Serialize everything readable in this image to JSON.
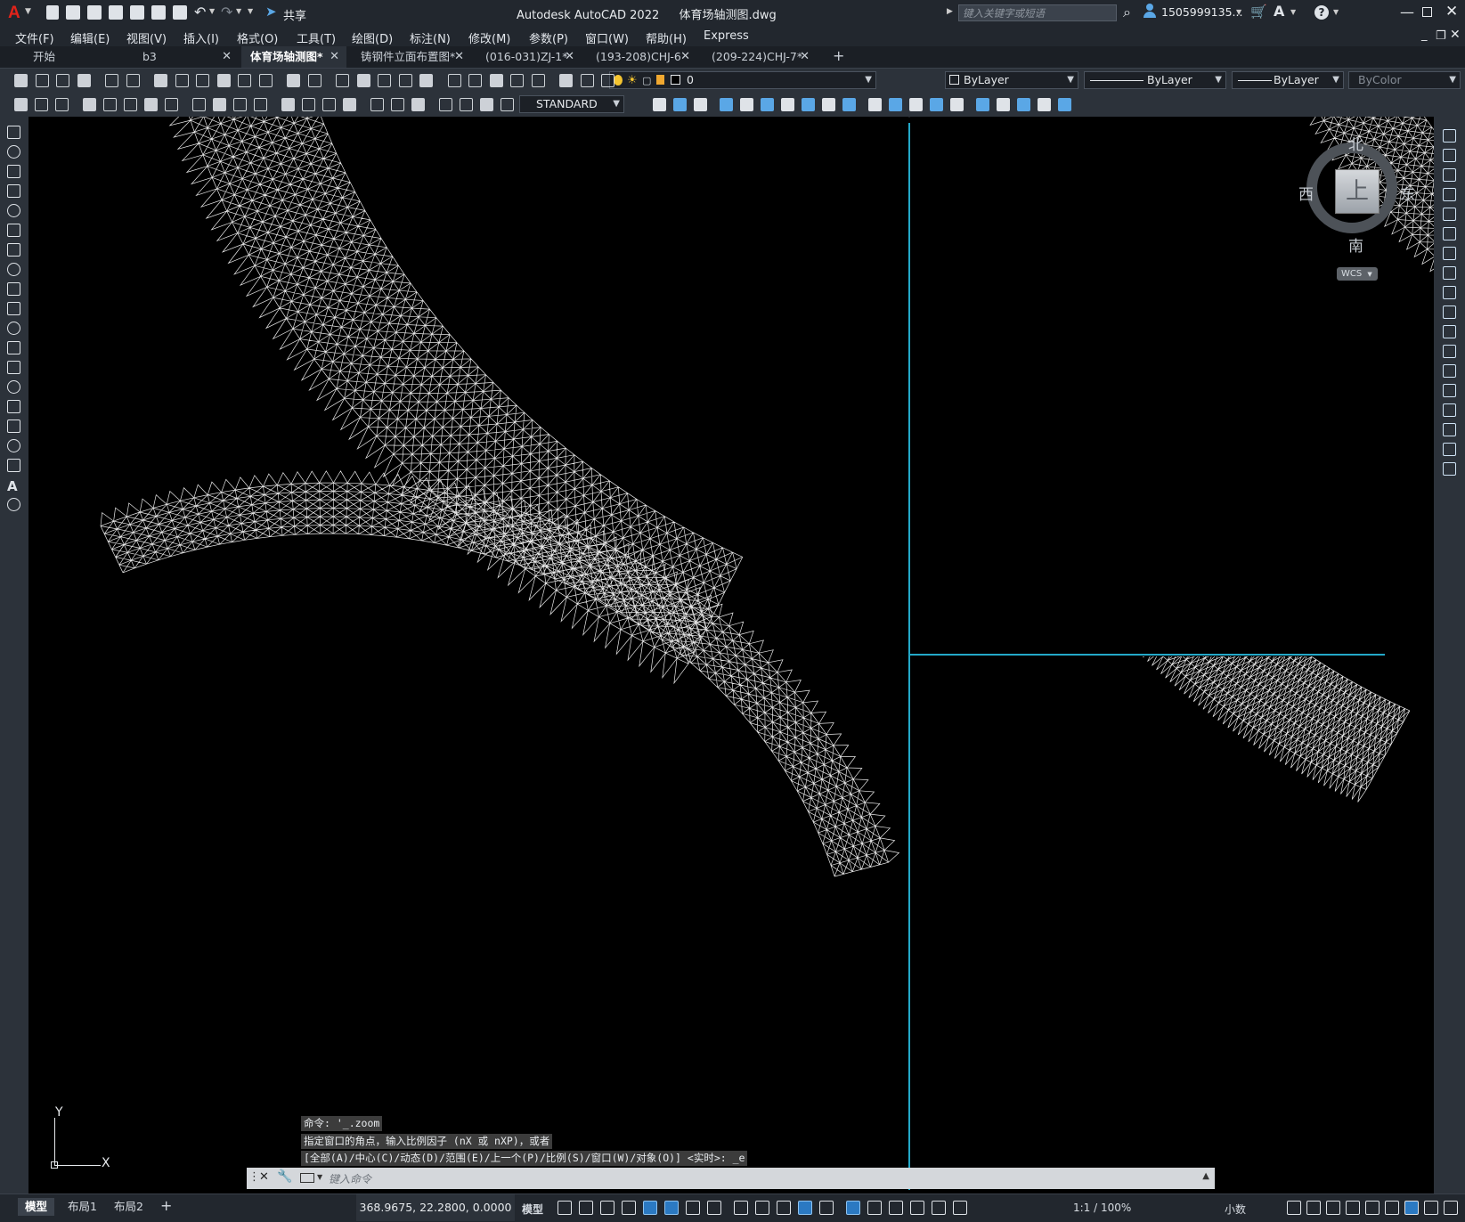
{
  "app": {
    "logo": "A",
    "title": "Autodesk AutoCAD 2022",
    "filename": "体育场轴测图.dwg",
    "search_placeholder": "键入关键字或短语",
    "user": "1505999135...",
    "share_label": "共享",
    "colors": {
      "accent": "#23a8c8",
      "bg_dark": "#22272e",
      "viewport": "#000000",
      "wire": "#e8e8e8"
    }
  },
  "menu": [
    "文件(F)",
    "编辑(E)",
    "视图(V)",
    "插入(I)",
    "格式(O)",
    "工具(T)",
    "绘图(D)",
    "标注(N)",
    "修改(M)",
    "参数(P)",
    "窗口(W)",
    "帮助(H)",
    "Express"
  ],
  "tabs": [
    {
      "label": "开始",
      "closable": false
    },
    {
      "label": "b3",
      "closable": true
    },
    {
      "label": "体育场轴测图*",
      "closable": true,
      "active": true
    },
    {
      "label": "铸钢件立面布置图*",
      "closable": true
    },
    {
      "label": "(016-031)ZJ-1*",
      "closable": true
    },
    {
      "label": "(193-208)CHJ-6",
      "closable": true
    },
    {
      "label": "(209-224)CHJ-7*",
      "closable": true
    }
  ],
  "properties": {
    "layer": "0",
    "color": "ByLayer",
    "linetype": "ByLayer",
    "lineweight": "ByLayer",
    "plotstyle": "ByColor",
    "textstyle": "STANDARD"
  },
  "viewcube": {
    "north": "北",
    "south": "南",
    "east": "东",
    "west": "西",
    "face": "上",
    "wcs": "WCS"
  },
  "ucs": {
    "x": "X",
    "y": "Y"
  },
  "command": {
    "history": [
      "命令: '_.zoom",
      "指定窗口的角点，输入比例因子 (nX 或 nXP)，或者",
      "[全部(A)/中心(C)/动态(D)/范围(E)/上一个(P)/比例(S)/窗口(W)/对象(O)] <实时>: _e"
    ],
    "placeholder": "键入命令"
  },
  "status": {
    "layout_tabs": [
      "模型",
      "布局1",
      "布局2"
    ],
    "coords": "368.9675, 22.2800, 0.0000",
    "model": "模型",
    "scale": "1:1 / 100%",
    "units": "小数"
  }
}
